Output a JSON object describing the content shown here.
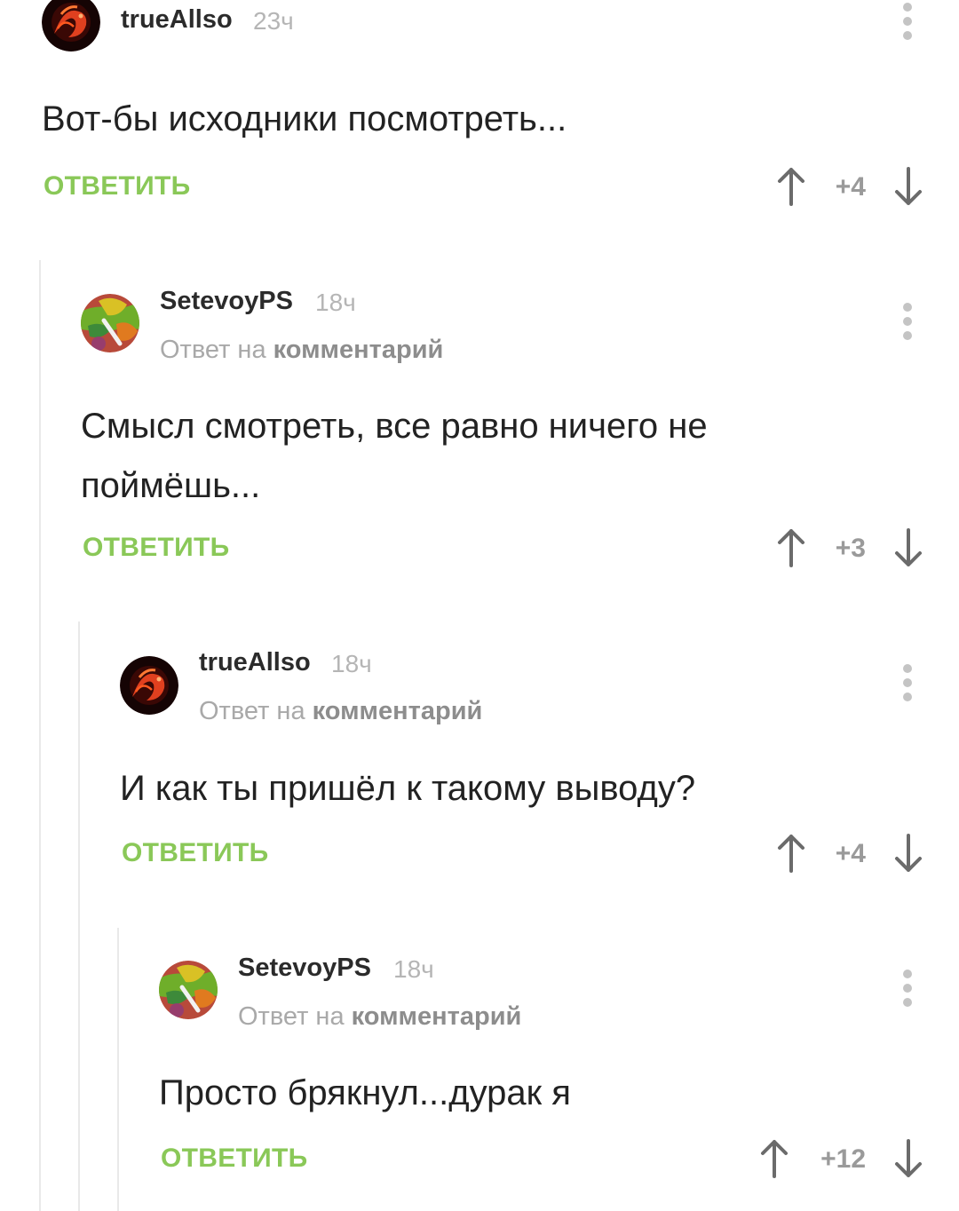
{
  "comments": [
    {
      "author": "trueAllso",
      "time": "23ч",
      "text": "Вот-бы исходники посмотреть...",
      "reply_label": "ОТВЕТИТЬ",
      "rating": "+4",
      "avatar_icon": "dragon-avatar-icon"
    },
    {
      "author": "SetevoyPS",
      "time": "18ч",
      "reply_prefix": "Ответ на",
      "reply_link": "комментарий",
      "text_line1": "Смысл смотреть, все равно ничего не",
      "text_line2": "поймёшь...",
      "reply_label": "ОТВЕТИТЬ",
      "rating": "+3",
      "avatar_icon": "leaf-avatar-icon"
    },
    {
      "author": "trueAllso",
      "time": "18ч",
      "reply_prefix": "Ответ на",
      "reply_link": "комментарий",
      "text": "И как ты пришёл к такому выводу?",
      "reply_label": "ОТВЕТИТЬ",
      "rating": "+4",
      "avatar_icon": "dragon-avatar-icon"
    },
    {
      "author": "SetevoyPS",
      "time": "18ч",
      "reply_prefix": "Ответ на",
      "reply_link": "комментарий",
      "text": "Просто брякнул...дурак я",
      "reply_label": "ОТВЕТИТЬ",
      "rating": "+12",
      "avatar_icon": "leaf-avatar-icon"
    }
  ],
  "colors": {
    "accent_green": "#8ac858",
    "thread_line": "#e9e9e9",
    "muted_text": "#b5b5b5"
  }
}
